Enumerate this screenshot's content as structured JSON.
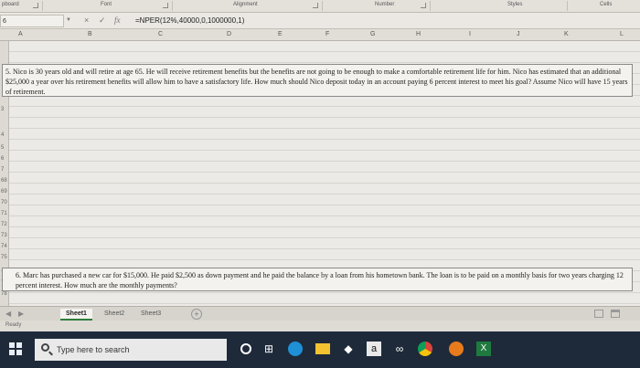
{
  "ribbon": {
    "groups": [
      "pboard",
      "Font",
      "Alignment",
      "Number",
      "Styles",
      "Cells"
    ]
  },
  "formula_bar": {
    "name_box": "6",
    "cancel_icon": "×",
    "enter_icon": "✓",
    "fx_label": "fx",
    "formula": "=NPER(12%,40000,0,1000000,1)"
  },
  "columns": [
    "A",
    "B",
    "C",
    "D",
    "E",
    "F",
    "G",
    "H",
    "I",
    "J",
    "K",
    "L"
  ],
  "rows": [
    "3",
    "4",
    "5",
    "6",
    "7",
    "68",
    "69",
    "70",
    "71",
    "72",
    "73",
    "74",
    "75",
    "76",
    "77",
    "78"
  ],
  "question5": "5. Nico is 30 years old and will retire at age 65. He will receive retirement benefits but the benefits are not going to be enough to make a comfortable retirement life for him. Nico has estimated that an additional $25,000 a year over his retirement benefits will allow him to have a satisfactory life. How much should Nico deposit today in an account paying 6 percent interest to meet his goal? Assume Nico will have 15 years of retirement.",
  "question6": "6. Marc has purchased a new car for $15,000. He paid $2,500 as down payment and he paid the balance by a loan from his hometown bank. The loan is to be paid on a monthly basis for two years charging 12 percent interest. How much are the monthly payments?",
  "sheet_tabs": [
    "Sheet1",
    "Sheet2",
    "Sheet3"
  ],
  "status": {
    "text": "Ready"
  },
  "taskbar": {
    "search_placeholder": "Type here to search",
    "apps": [
      "cortana-icon",
      "task-view-icon",
      "edge-icon",
      "file-explorer-icon",
      "dropbox-icon",
      "amazon-icon",
      "tripadvisor-icon",
      "chrome-icon",
      "app-icon",
      "excel-icon"
    ]
  },
  "colors": {
    "accent": "#2f7d3a",
    "taskbar": "#1e2a3a"
  }
}
